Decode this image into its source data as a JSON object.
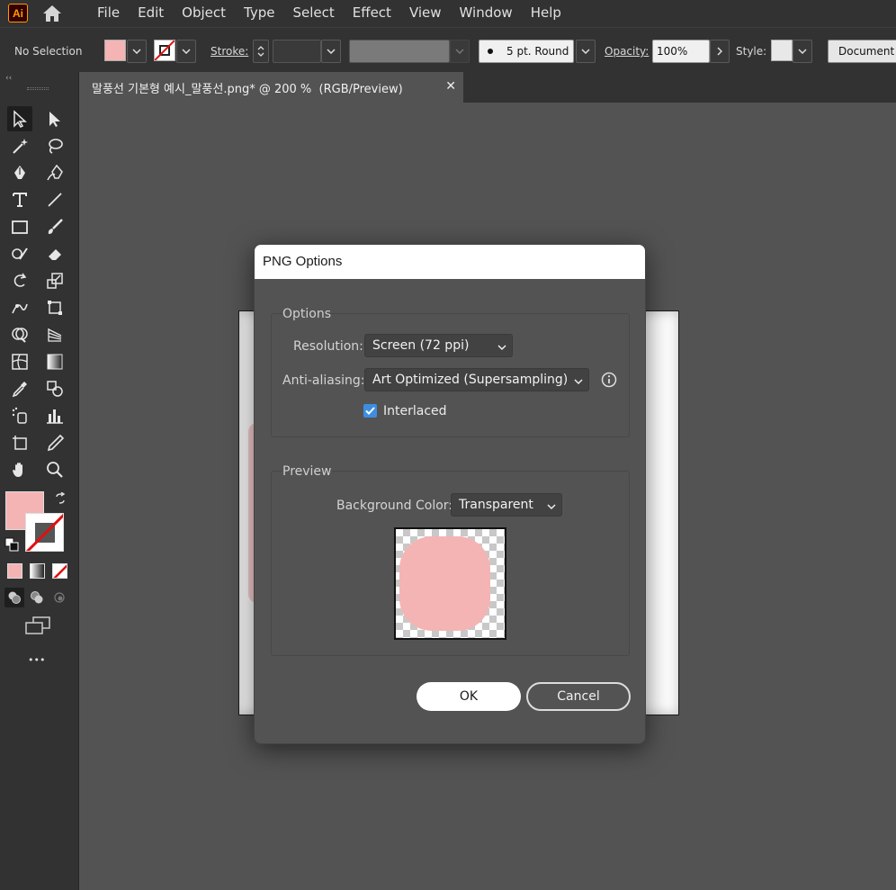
{
  "app": {
    "logo_text": "Ai",
    "menu": [
      "File",
      "Edit",
      "Object",
      "Type",
      "Select",
      "Effect",
      "View",
      "Window",
      "Help"
    ]
  },
  "controlbar": {
    "selection_status": "No Selection",
    "fill_color": "#f4b4b4",
    "stroke_label": "Stroke:",
    "brush_label": "5 pt. Round",
    "opacity_label": "Opacity:",
    "opacity_value": "100%",
    "style_label": "Style:",
    "document_setup_label": "Document S"
  },
  "document_tab": {
    "title": "말풍선 기본형 예시_말풍선.png* @ 200 %  (RGB/Preview)",
    "close_glyph": "✕"
  },
  "toolbar": {
    "grip": "‹‹",
    "more_glyph": "•••",
    "tools": [
      "selection-tool",
      "direct-selection-tool",
      "magic-wand-tool",
      "lasso-tool",
      "pen-tool",
      "curvature-tool",
      "type-tool",
      "line-segment-tool",
      "rectangle-tool",
      "paintbrush-tool",
      "shaper-tool",
      "eraser-tool",
      "rotate-tool",
      "scale-tool",
      "width-tool",
      "free-transform-tool",
      "shape-builder-tool",
      "perspective-grid-tool",
      "mesh-tool",
      "gradient-tool",
      "eyedropper-tool",
      "blend-tool",
      "symbol-sprayer-tool",
      "column-graph-tool",
      "artboard-tool",
      "slice-tool",
      "hand-tool",
      "zoom-tool"
    ]
  },
  "dialog": {
    "title": "PNG Options",
    "options_group_label": "Options",
    "resolution_label": "Resolution:",
    "resolution_value": "Screen (72 ppi)",
    "antialiasing_label": "Anti-aliasing:",
    "antialiasing_value": "Art Optimized (Supersampling)",
    "interlaced_label": "Interlaced",
    "interlaced_checked": true,
    "preview_group_label": "Preview",
    "background_color_label": "Background Color:",
    "background_color_value": "Transparent",
    "preview_shape_color": "#f4b4b4",
    "ok_label": "OK",
    "cancel_label": "Cancel"
  },
  "colors": {
    "accent_blue": "#3d8ee0",
    "menu_bg": "#323232",
    "workspace_bg": "#535353"
  }
}
